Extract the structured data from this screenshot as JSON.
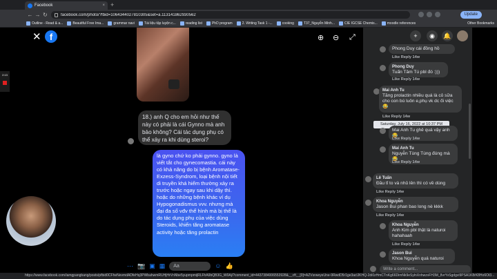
{
  "browser": {
    "tab_title": "Facebook",
    "tab_close": "×",
    "new_tab": "+",
    "nav": {
      "back": "←",
      "forward": "→",
      "reload": "↻",
      "home": "⌂"
    },
    "url": "facebook.com/photo/?fbid=1064344027810305&set=a.113141862930562",
    "update_label": "Update",
    "bookmarks": [
      "Outline - Read & a...",
      "Beautiful Free Ima...",
      "grammar navi",
      "Tài liệu tập luyện c...",
      "reading list",
      "PhD program",
      "2. Writing Task 1 -...",
      "cooking",
      "T37_Nguyễn Minh...",
      "CIE IGCSE Chemis...",
      "moodle references"
    ],
    "other_bookmarks": "Other Bookmarks",
    "status_url": "https://www.facebook.com/iamgpangbang/posts/pfbid0CFheNevmdADfeHq3PWbahwmRUHjHrVnNbe5yupmpmijRLFhA9bQB3G_W0Aj/?comment_id=4437384006553928&__cft__[0]=AZVsrweyeUne-9RwdD5r1ge3aclJKHQ-2di0zHmCTnKg66DimNk9eSylnXnhwzvFH3M_8vrYvSgdgvi9PSA1K8rK8Ho6Ot3..."
  },
  "viewer": {
    "close_icon": "✕",
    "logo_letter": "f",
    "zoom_in": "⊕",
    "zoom_out": "⊖",
    "recording_timer": "2:13",
    "gray_message": "18.) anh Q cho em hỏi như thế này có phải là cái Gynno mà anh bảo không? Cái tác dụng phụ có thể xảy ra khi dùng steroi?",
    "blue_message": "là gyno chứ ko phải gynno. gyno là viết tắt cho gynecomastia. cái này có khả năng do bị bệnh Aromatase-Exzess-Syndrom, loại bệnh nội tiết di truyền khá hiếm thường xảy ra trước hoặc ngay sau khi dậy thì. hoặc do những bệnh khác ví dụ Hypogonadismus vvv. nhưng mà đại đa số vđv thể hình mà bị thể là do tác dụng phụ của việc dùng Steroids, khiến tăng aromatase activity hoặc tăng prolactin",
    "composer_placeholder": "Aa",
    "composer_icons": [
      "⋯",
      "📷",
      "▣",
      "▦"
    ],
    "emoji": "☺",
    "like": "👍"
  },
  "comments": {
    "header_icons": [
      "+",
      "◉",
      "🔔"
    ],
    "items": [
      {
        "name": "",
        "text": "Phong Duy cái đồng hồ",
        "emoji": "😊",
        "actions": "Like  Reply  14w"
      },
      {
        "name": "Phong Duy",
        "text": "Tuấn Tâm Tú pbl đó :)))",
        "actions": "Like  Reply  14w"
      },
      {
        "name": "Mai Anh Tu",
        "text": "Tăng prolactin nhiều quá là cỏ sữa cho con bú luôn e,phụ vk dc ối việc😂",
        "actions": "Like  Reply  14w",
        "reactions": "3"
      },
      {
        "name": "",
        "text": "Mai Anh Tu ghê quá vậy anh 😂",
        "actions": "Like  Reply  14w"
      },
      {
        "name": "Mai Anh Tu",
        "text": "Nguyễn Tùng Tùng đúng mà 😂",
        "actions": "Like  Reply  14w"
      },
      {
        "name": "Lê Tuấn",
        "text": "Đầu tỉ to và nhủ lên thì có về dùng",
        "actions": "Like  Reply  14w"
      },
      {
        "name": "Khoa Nguyễn",
        "text": "Jason Bui phan bao long nè kkkk",
        "actions": "Like  Reply  14w",
        "reactions": "2"
      },
      {
        "name": "Khoa Nguyễn",
        "text": "Anh Kim pbl thật là naturoi hahahaah",
        "actions": "Like  Reply  14w"
      },
      {
        "name": "Jason Bui",
        "text": "Khoa Nguyễn quá naturoi",
        "actions": "Like  Reply  14w"
      }
    ],
    "tooltip": "Saturday, July 16, 2022 at 10:37 PM",
    "write_placeholder": "Write a comment..."
  }
}
